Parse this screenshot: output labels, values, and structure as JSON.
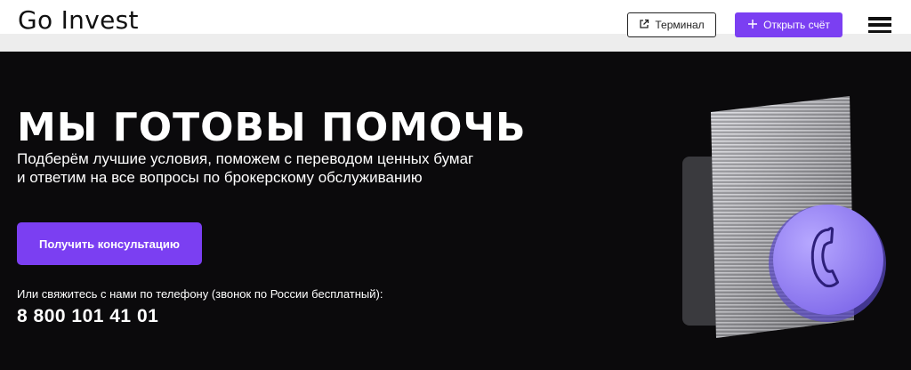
{
  "header": {
    "logo": "Go Invest",
    "terminal_label": "Терминал",
    "open_account_label": "Открыть счёт",
    "accent_color": "#7b3ff2"
  },
  "hero": {
    "title": "МЫ ГОТОВЫ ПОМОЧЬ",
    "subtitle_line1": "Подберём лучшие условия, поможем с переводом ценных бумаг",
    "subtitle_line2": "и ответим на все вопросы по брокерскому обслуживанию",
    "consult_button_label": "Получить консультацию",
    "contact_text": "Или свяжитесь с нами по телефону (звонок по России бесплатный):",
    "phone": "8 800 101 41 01",
    "illustration_icon": "phone-icon"
  }
}
